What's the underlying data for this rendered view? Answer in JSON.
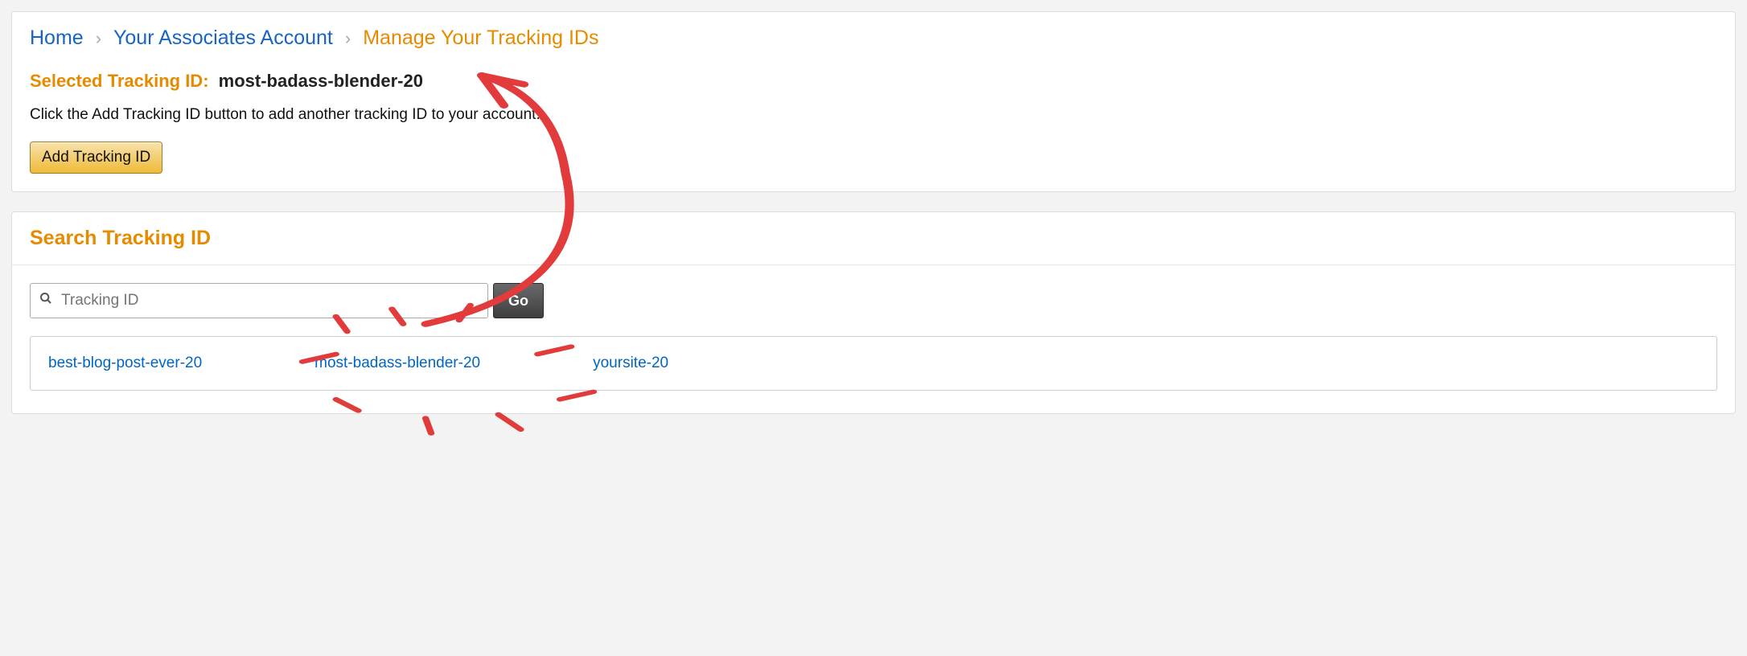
{
  "breadcrumb": {
    "home": "Home",
    "account": "Your Associates Account",
    "current": "Manage Your Tracking IDs"
  },
  "selected": {
    "label": "Selected Tracking ID:",
    "value": "most-badass-blender-20"
  },
  "help_text": "Click the Add Tracking ID button to add another tracking ID to your account.",
  "buttons": {
    "add": "Add Tracking ID",
    "go": "Go"
  },
  "search": {
    "title": "Search Tracking ID",
    "placeholder": "Tracking ID"
  },
  "results": [
    "best-blog-post-ever-20",
    "most-badass-blender-20",
    "yoursite-20"
  ]
}
